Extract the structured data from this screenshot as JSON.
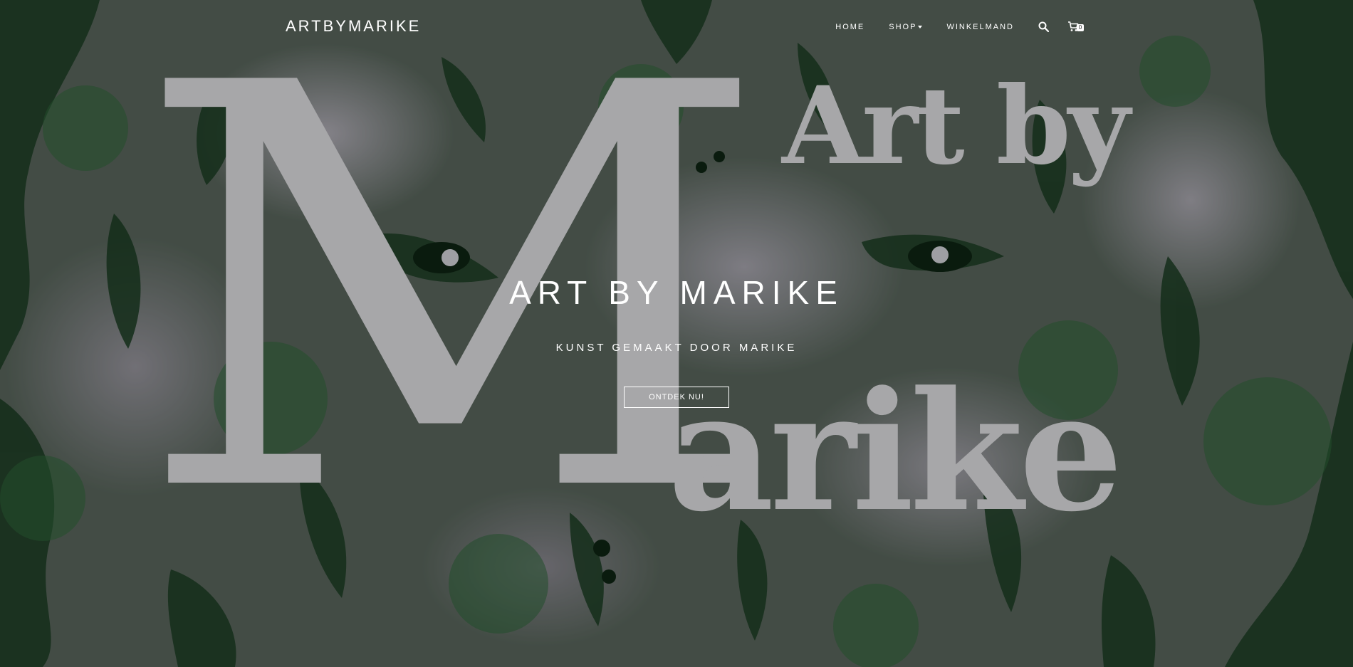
{
  "nav": {
    "brand": "ARTBYMARIKE",
    "items": [
      {
        "label": "HOME"
      },
      {
        "label": "SHOP"
      },
      {
        "label": "WINKELMAND"
      }
    ],
    "search_icon": "search-icon",
    "cart_icon": "cart-icon",
    "cart_count": "0"
  },
  "logo": {
    "initial": "M",
    "line1": "Art by",
    "line2": "arike"
  },
  "hero": {
    "title": "ART BY MARIKE",
    "subtitle": "KUNST GEMAAKT DOOR MARIKE",
    "cta_label": "ONTDEK NU!"
  },
  "colors": {
    "nav_text": "#ffffff",
    "logo_gray": "#a7a7a9",
    "art_green": "#1f4a2a"
  }
}
